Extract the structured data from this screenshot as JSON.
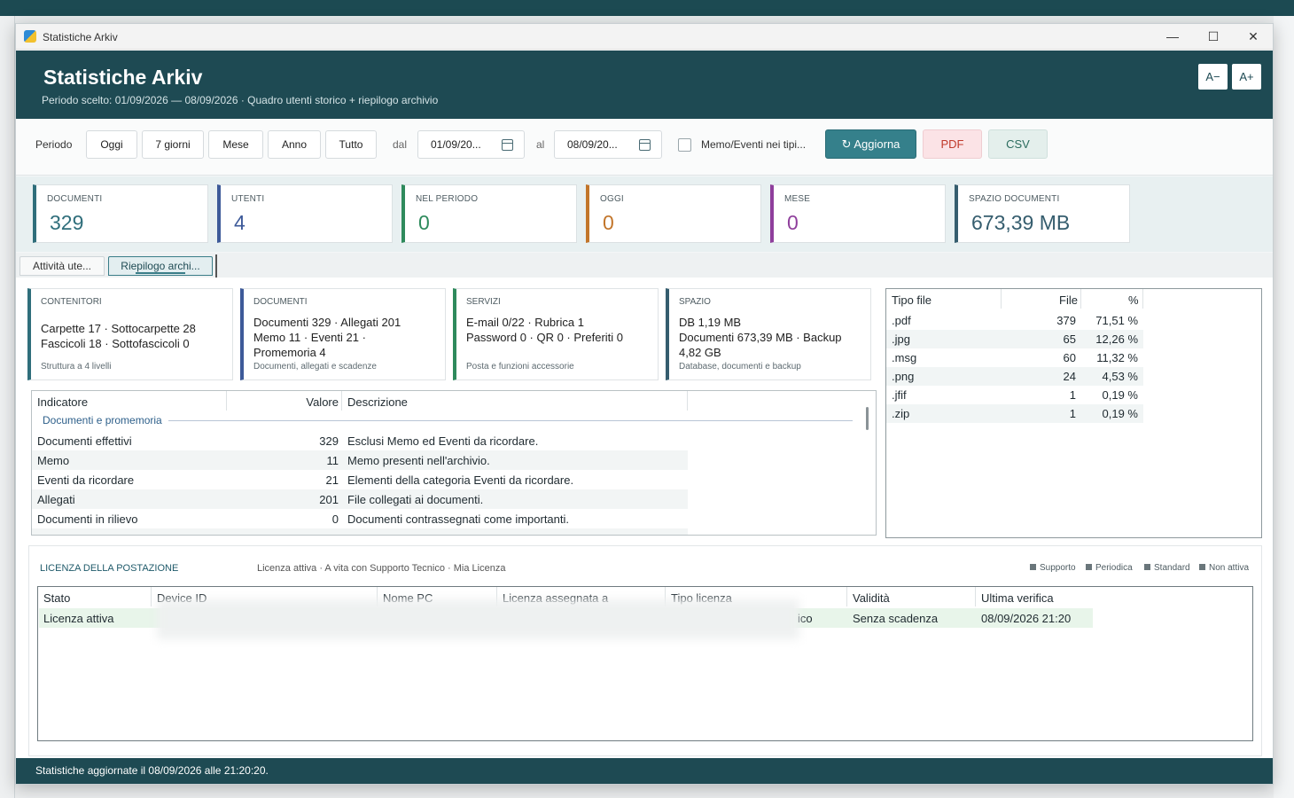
{
  "window": {
    "title": "Statistiche Arkiv",
    "controls": {
      "minimize": "—",
      "maximize": "☐",
      "close": "✕"
    }
  },
  "header": {
    "title": "Statistiche Arkiv",
    "subtitle": "Periodo scelto: 01/09/2026 — 08/09/2026  ·  Quadro utenti storico + riepilogo archivio",
    "font_minus": "A−",
    "font_plus": "A+"
  },
  "toolbar": {
    "period_label": "Periodo",
    "ranges": [
      "Oggi",
      "7 giorni",
      "Mese",
      "Anno",
      "Tutto"
    ],
    "from_label": "dal",
    "from_value": "01/09/20...",
    "to_label": "al",
    "to_value": "08/09/20...",
    "memo_checkbox_label": "Memo/Eventi nei tipi...",
    "memo_checked": false,
    "refresh_label": "↻  Aggiorna",
    "pdf_label": "PDF",
    "csv_label": "CSV"
  },
  "kpis": [
    {
      "label": "DOCUMENTI",
      "value": "329",
      "color": "#2f6e7b"
    },
    {
      "label": "UTENTI",
      "value": "4",
      "color": "#3d5a99"
    },
    {
      "label": "NEL PERIODO",
      "value": "0",
      "color": "#2e8a5c"
    },
    {
      "label": "OGGI",
      "value": "0",
      "color": "#c2752a"
    },
    {
      "label": "MESE",
      "value": "0",
      "color": "#8f3f9c"
    },
    {
      "label": "SPAZIO DOCUMENTI",
      "value": "673,39 MB",
      "color": "#355d6e"
    }
  ],
  "tabs": [
    {
      "label": "Attività ute...",
      "active": false
    },
    {
      "label": "Riepilogo archi...",
      "active": true
    }
  ],
  "summary_cards": [
    {
      "heading": "CONTENITORI",
      "body": "Carpette 17  ·  Sottocarpette 28\nFascicoli 18  ·  Sottofascicoli 0",
      "footer": "Struttura a 4 livelli"
    },
    {
      "heading": "DOCUMENTI",
      "body": "Documenti 329  ·  Allegati 201\nMemo 11  ·  Eventi 21  ·\nPromemoria 4",
      "footer": "Documenti, allegati e scadenze"
    },
    {
      "heading": "SERVIZI",
      "body": "E-mail 0/22  ·  Rubrica 1\nPassword 0  ·  QR 0  ·  Preferiti 0",
      "footer": "Posta e funzioni accessorie"
    },
    {
      "heading": "SPAZIO",
      "body": "DB 1,19 MB\nDocumenti 673,39 MB  ·  Backup\n4,82 GB",
      "footer": "Database, documenti e backup"
    }
  ],
  "indicators": {
    "columns": [
      "Indicatore",
      "Valore",
      "Descrizione"
    ],
    "group": "Documenti e promemoria",
    "rows": [
      {
        "name": "Documenti effettivi",
        "value": "329",
        "desc": "Esclusi Memo ed Eventi da ricordare."
      },
      {
        "name": "Memo",
        "value": "11",
        "desc": "Memo presenti nell'archivio."
      },
      {
        "name": "Eventi da ricordare",
        "value": "21",
        "desc": "Elementi della categoria Eventi da ricordare."
      },
      {
        "name": "Allegati",
        "value": "201",
        "desc": "File collegati ai documenti."
      },
      {
        "name": "Documenti in rilievo",
        "value": "0",
        "desc": "Documenti contrassegnati come importanti."
      }
    ]
  },
  "file_types": {
    "columns": [
      "Tipo file",
      "File",
      "%"
    ],
    "rows": [
      {
        "type": ".pdf",
        "files": "379",
        "pct": "71,51 %"
      },
      {
        "type": ".jpg",
        "files": "65",
        "pct": "12,26 %"
      },
      {
        "type": ".msg",
        "files": "60",
        "pct": "11,32 %"
      },
      {
        "type": ".png",
        "files": "24",
        "pct": "4,53 %"
      },
      {
        "type": ".jfif",
        "files": "1",
        "pct": "0,19 %"
      },
      {
        "type": ".zip",
        "files": "1",
        "pct": "0,19 %"
      }
    ]
  },
  "license": {
    "title": "LICENZA DELLA POSTAZIONE",
    "description": "Licenza attiva · A vita con Supporto Tecnico · Mia Licenza",
    "legend": [
      "Supporto",
      "Periodica",
      "Standard",
      "Non attiva"
    ],
    "columns": [
      "Stato",
      "Device ID",
      "Nome PC",
      "Licenza assegnata a",
      "Tipo licenza",
      "Validità",
      "Ultima verifica"
    ],
    "row": {
      "stato": "Licenza attiva",
      "tipo_tail": "ico",
      "validita": "Senza scadenza",
      "ultima_verifica": "08/09/2026 21:20"
    }
  },
  "status": {
    "text": "Statistiche aggiornate il 08/09/2026 alle 21:20:20."
  }
}
